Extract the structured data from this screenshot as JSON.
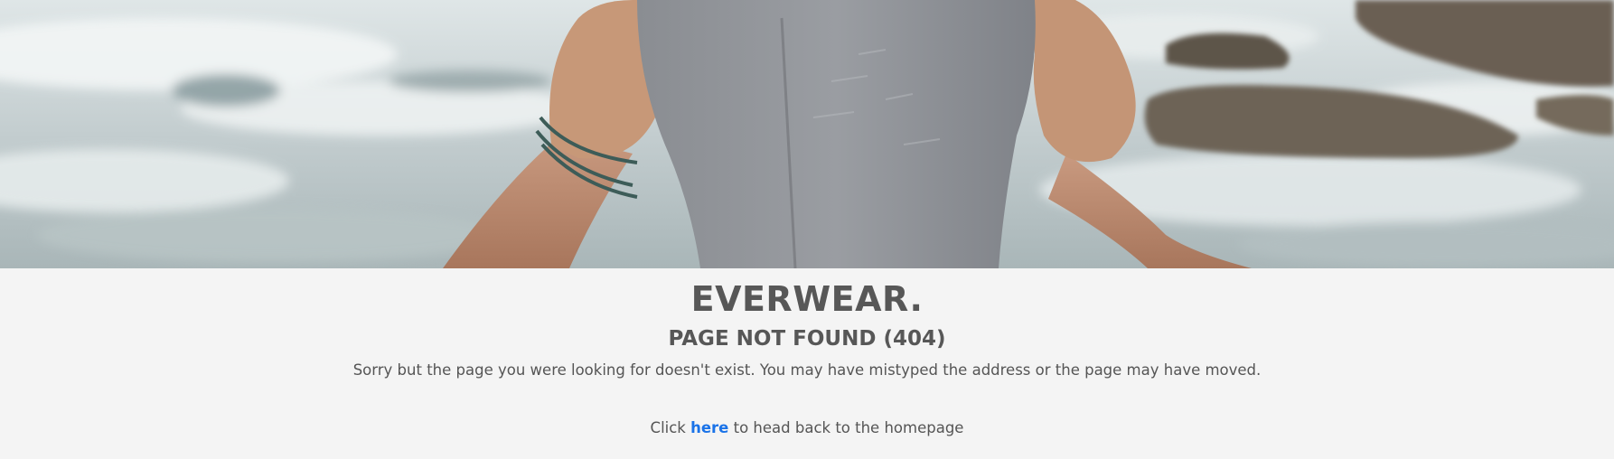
{
  "hero": {
    "image_name": "hero-photo-person-holding-grey-tshirt-by-river"
  },
  "brand": {
    "name": "EVERWEAR."
  },
  "error": {
    "title": "PAGE NOT FOUND (404)",
    "message": "Sorry but the page you were looking for doesn't exist. You may have mistyped the address or the page may have moved."
  },
  "back_link": {
    "prefix": "Click ",
    "link_label": "here",
    "suffix": " to head back to the homepage"
  },
  "colors": {
    "background": "#f4f4f4",
    "heading": "#575757",
    "body_text": "#555555",
    "link": "#1a73e8"
  }
}
